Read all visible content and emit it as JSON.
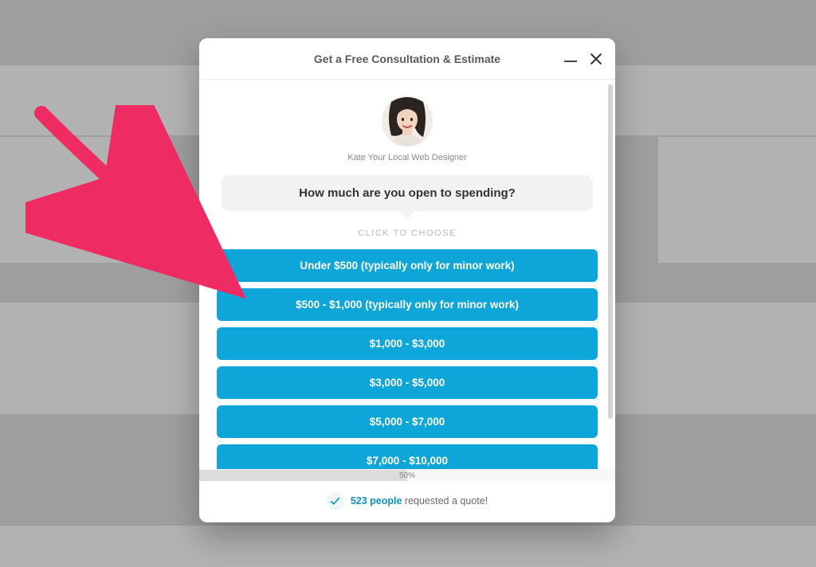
{
  "modal": {
    "title": "Get a Free Consultation & Estimate",
    "designer_label": "Kate Your Local Web Designer",
    "question": "How much are you open to spending?",
    "choose_label": "CLICK TO CHOOSE",
    "options": [
      "Under $500 (typically only for minor work)",
      "$500 - $1,000 (typically only for minor work)",
      "$1,000 - $3,000",
      "$3,000 - $5,000",
      "$5,000 - $7,000",
      "$7,000 - $10,000"
    ],
    "progress": {
      "percent_label": "50%",
      "percent_width": "50%"
    },
    "social_proof": {
      "count": "523 people",
      "rest": " requested a quote!"
    }
  },
  "colors": {
    "accent": "#0ea5d8",
    "arrow": "#ef2b64"
  }
}
